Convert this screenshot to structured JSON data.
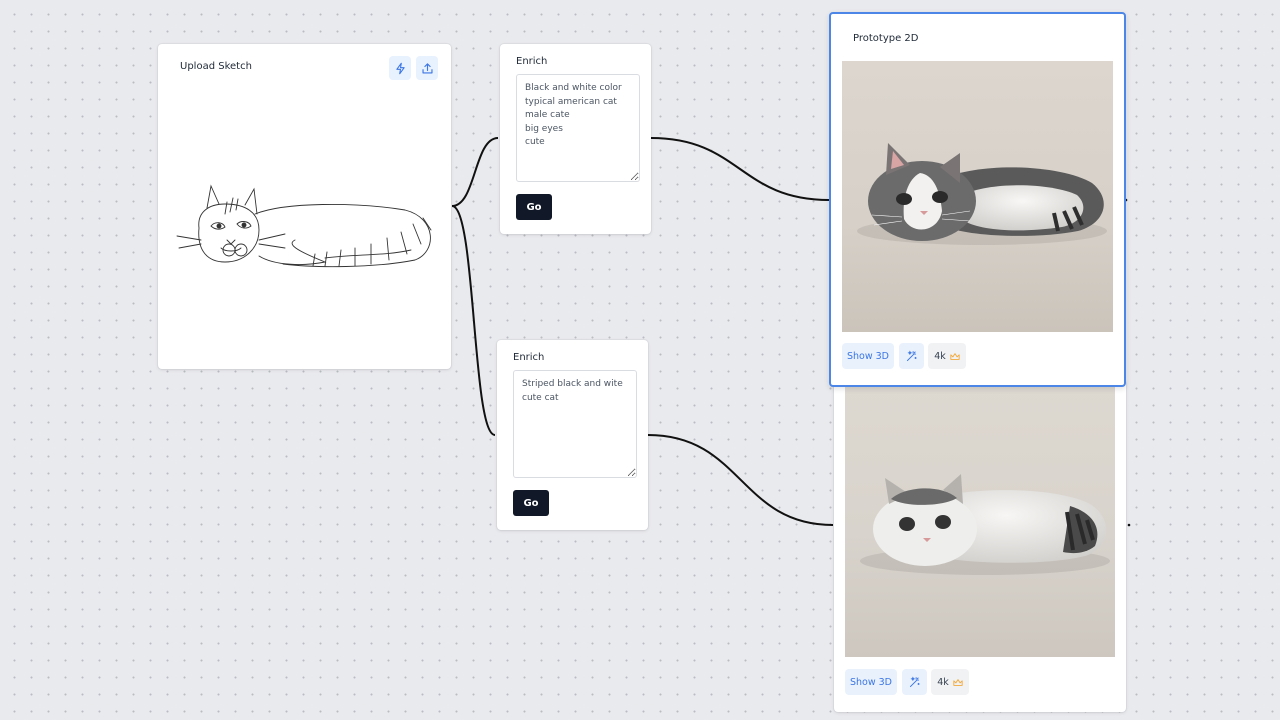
{
  "nodes": {
    "upload": {
      "title": "Upload Sketch"
    },
    "enrich1": {
      "title": "Enrich",
      "prompt": "Black and white color\ntypical american cat\nmale cate\nbig eyes\ncute",
      "go_label": "Go"
    },
    "enrich2": {
      "title": "Enrich",
      "prompt": "Striped black and wite\ncute cat",
      "go_label": "Go"
    },
    "proto1": {
      "title": "Prototype 2D",
      "show3d_label": "Show 3D",
      "res_label": "4k"
    },
    "proto2": {
      "show3d_label": "Show 3D",
      "res_label": "4k"
    }
  },
  "icons": {
    "upload_actions": [
      "lightning-icon",
      "upload-icon"
    ],
    "proto_actions": [
      "magic-wand-icon",
      "crown-icon"
    ]
  },
  "colors": {
    "selected_border": "#4c86e6",
    "accent": "#3b76e4",
    "go_button": "#111827",
    "canvas": "#e9eaed",
    "crown": "#f2a93b"
  }
}
